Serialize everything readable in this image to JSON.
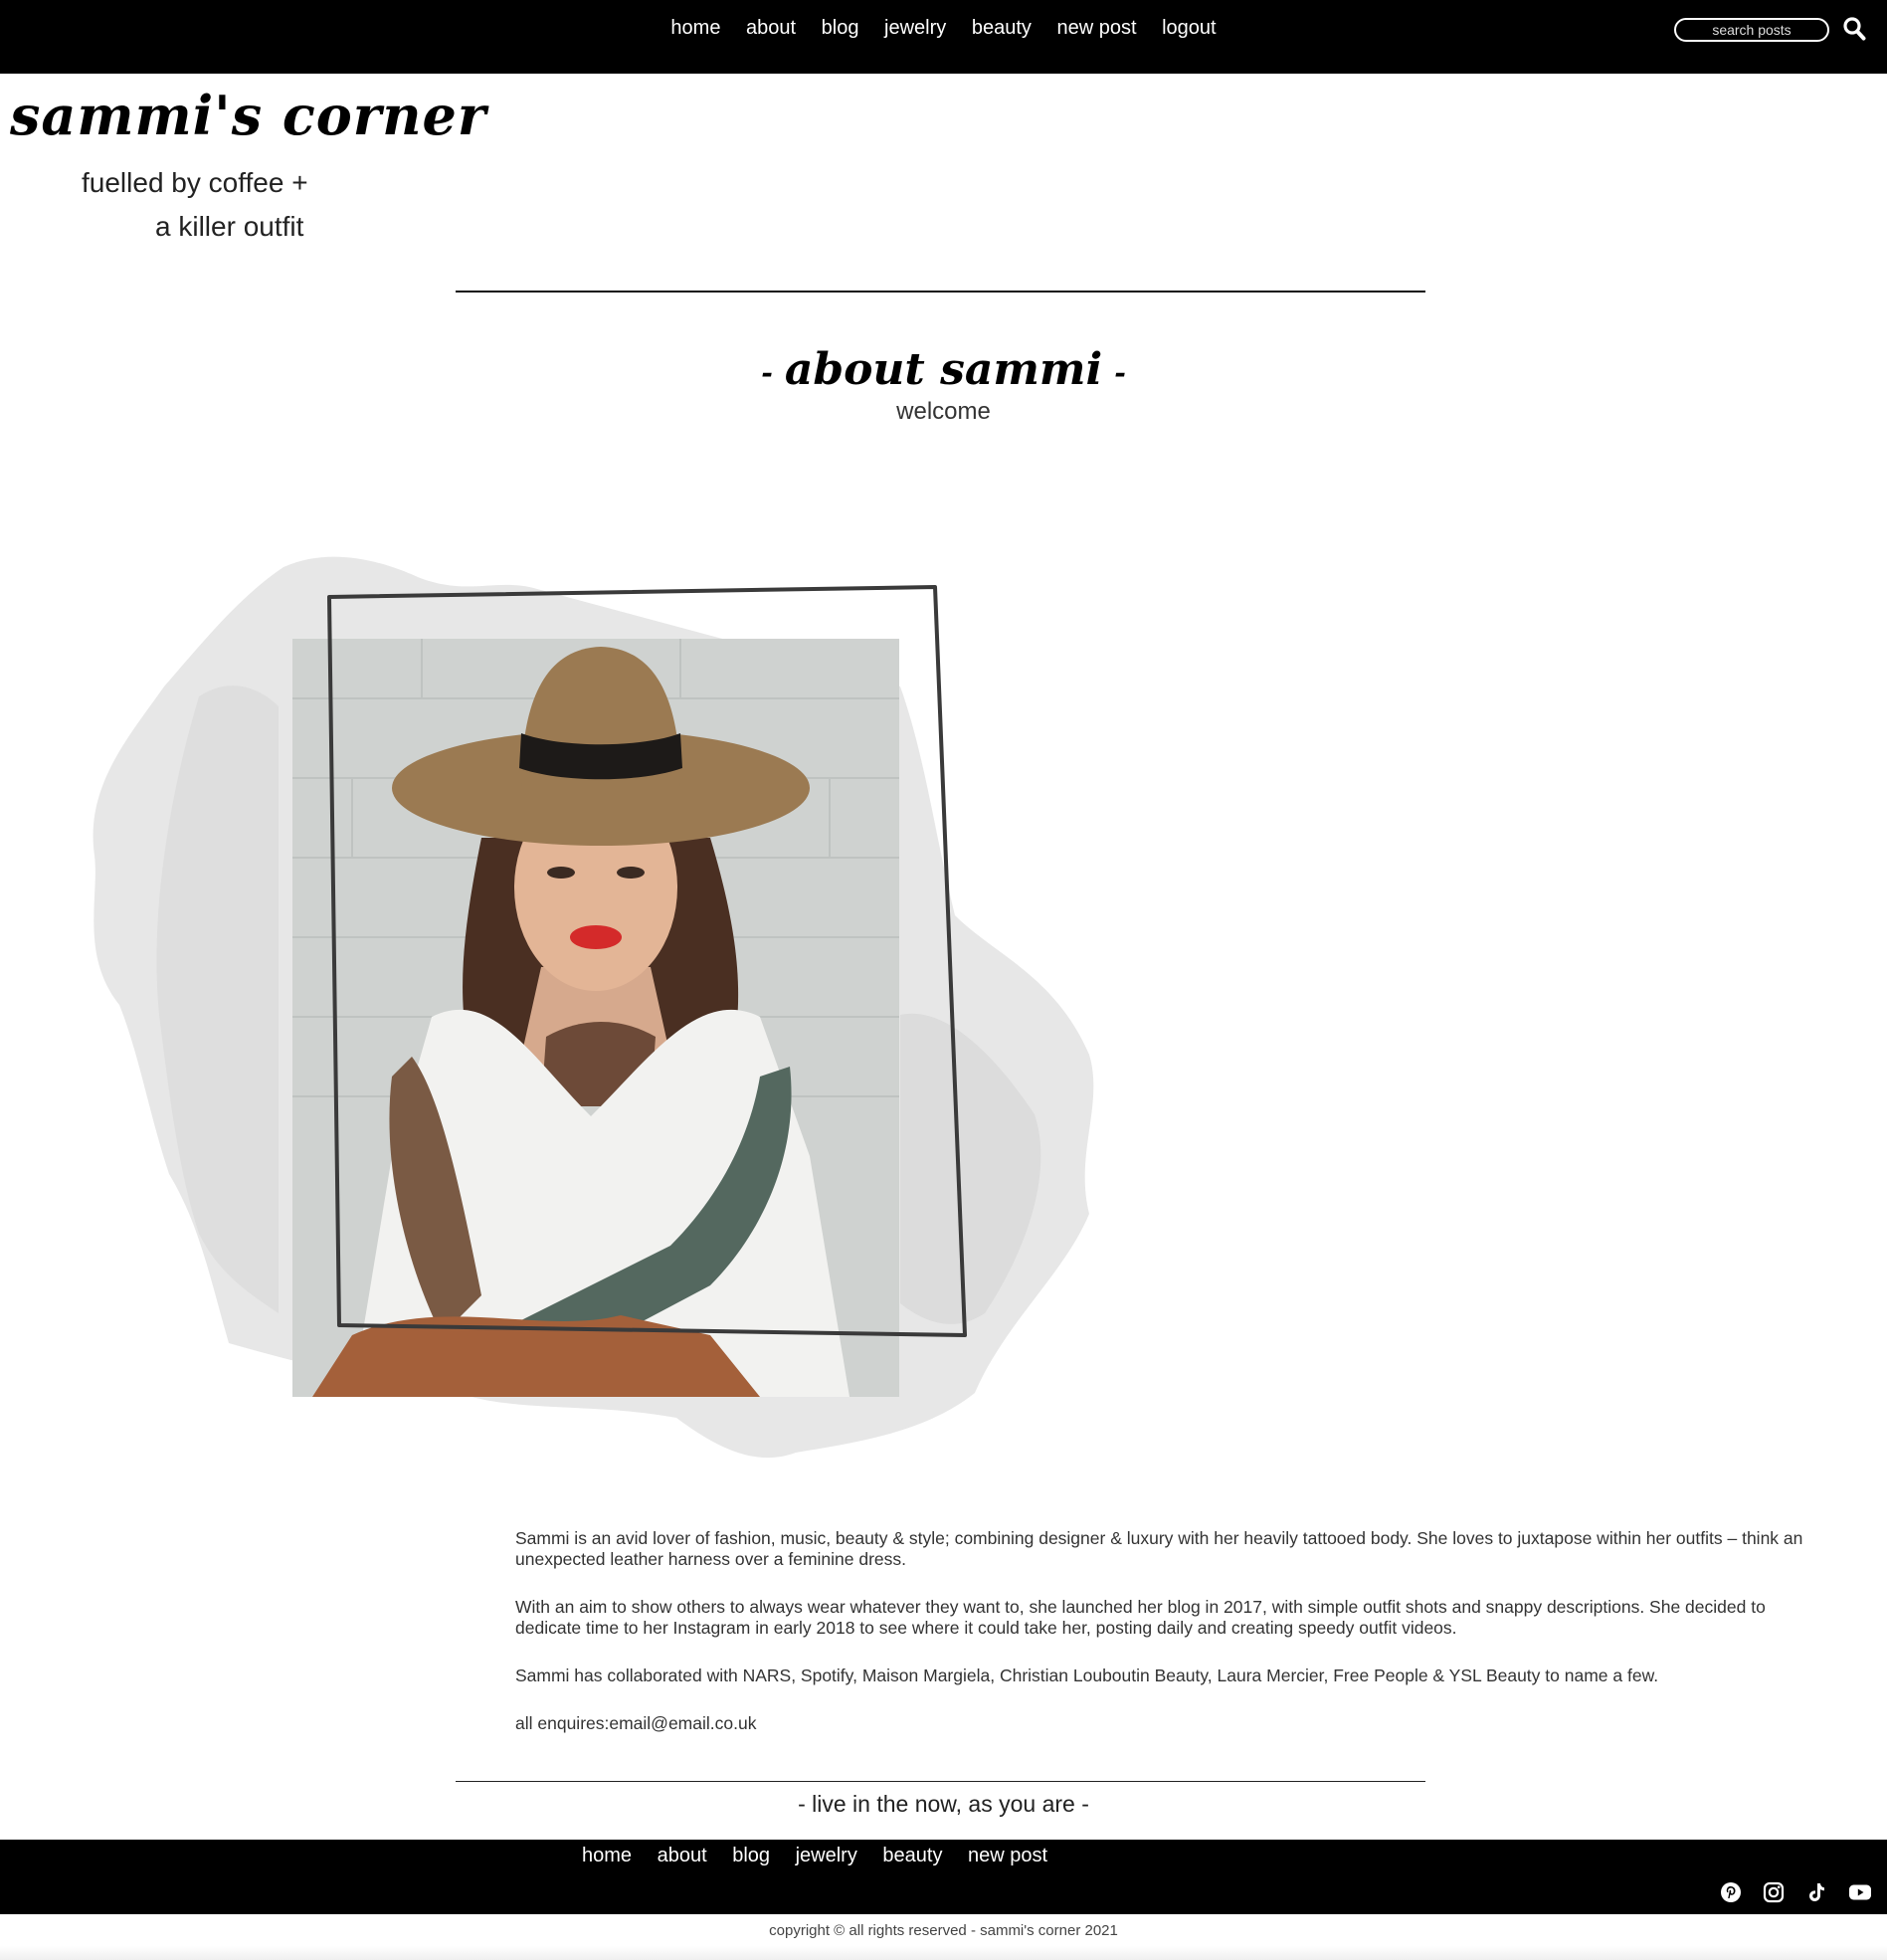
{
  "nav": {
    "items": [
      "home",
      "about",
      "blog",
      "jewelry",
      "beauty",
      "new post",
      "logout"
    ],
    "search_placeholder": "search posts"
  },
  "brand": {
    "logo": "sammi's corner",
    "tagline_line1": "fuelled by coffee +",
    "tagline_line2": "a killer outfit"
  },
  "page": {
    "title": "about sammi",
    "title_dash": "-",
    "subtitle": "welcome"
  },
  "bio": {
    "paragraphs": [
      "Sammi is an avid lover of fashion, music, beauty & style; combining designer & luxury with her heavily tattooed body. She loves to juxtapose within her outfits – think an unexpected leather harness over a feminine dress.",
      "With an aim to show others to always wear whatever they want to, she launched her blog in 2017, with simple outfit shots and snappy descriptions. She decided to dedicate time to her Instagram in early 2018 to see where it could take her, posting daily and creating speedy outfit videos.",
      "Sammi has collaborated with NARS, Spotify, Maison Margiela, Christian Louboutin Beauty, Laura Mercier, Free People & YSL Beauty to name a few."
    ],
    "enquiries": "all enquires:email@email.co.uk"
  },
  "motto": "- live in the now, as you are -",
  "footer": {
    "nav": [
      "home",
      "about",
      "blog",
      "jewelry",
      "beauty",
      "new post"
    ],
    "social": [
      "pinterest-icon",
      "instagram-icon",
      "tiktok-icon",
      "youtube-icon"
    ],
    "copyright": "copyright © all rights reserved - sammi's corner 2021"
  },
  "colors": {
    "header_bg": "#000000",
    "footer_bg": "#000000",
    "page_bg": "#ffffff",
    "brush": "#e6e6e6",
    "lip_red": "#d42a2a"
  }
}
